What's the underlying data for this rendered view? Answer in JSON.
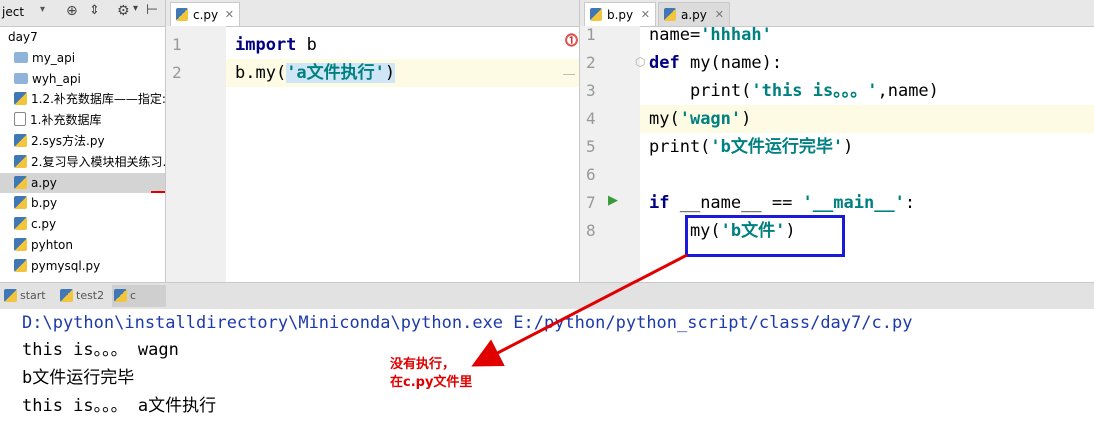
{
  "project_panel": {
    "header_label": "ject",
    "items": [
      {
        "label": "day7",
        "type": "folder-open"
      },
      {
        "label": "my_api",
        "type": "folder"
      },
      {
        "label": "wyh_api",
        "type": "folder"
      },
      {
        "label": "1.2.补充数据库——指定:",
        "type": "py"
      },
      {
        "label": "1.补充数据库",
        "type": "file"
      },
      {
        "label": "2.sys方法.py",
        "type": "py"
      },
      {
        "label": "2.复习导入模块相关练习.",
        "type": "py"
      },
      {
        "label": "a.py",
        "type": "py",
        "selected": true
      },
      {
        "label": "b.py",
        "type": "py"
      },
      {
        "label": "c.py",
        "type": "py"
      },
      {
        "label": "pyhton",
        "type": "py"
      },
      {
        "label": "pymysql.py",
        "type": "py"
      }
    ]
  },
  "editor_left": {
    "tabs": [
      {
        "label": "c.py",
        "active": true
      }
    ],
    "lines": [
      {
        "num": "1"
      },
      {
        "num": "2"
      }
    ],
    "code": {
      "l1_kw": "import",
      "l1_rest": " b",
      "l2_pre": "b.my(",
      "l2_str": "'a文件执行'",
      "l2_post": ")"
    }
  },
  "editor_right": {
    "tabs": [
      {
        "label": "b.py",
        "active": true
      },
      {
        "label": "a.py",
        "active": false
      }
    ],
    "line_numbers": [
      "1",
      "2",
      "3",
      "4",
      "5",
      "6",
      "7",
      "8"
    ],
    "code": {
      "l1_pre": "name=",
      "l1_str": "'hhhah'",
      "l2_kw": "def",
      "l2_rest": " my(name):",
      "l3_pre": "    print(",
      "l3_str": "'this is。。。'",
      "l3_post": ",name)",
      "l4_pre": "my(",
      "l4_str": "'wagn'",
      "l4_post": ")",
      "l5_pre": "print(",
      "l5_str": "'b文件运行完毕'",
      "l5_post": ")",
      "l7_kw": "if",
      "l7_mid": " __name__ == ",
      "l7_str": "'__main__'",
      "l7_post": ":",
      "l8_pre": "    my(",
      "l8_str": "'b文件'",
      "l8_post": ")"
    }
  },
  "run_tabs": [
    {
      "label": "start"
    },
    {
      "label": "test2"
    },
    {
      "label": "c",
      "active": true
    }
  ],
  "console_lines": [
    "D:\\python\\installdirectory\\Miniconda\\python.exe E:/python/python_script/class/day7/c.py",
    "this is。。。 wagn",
    "b文件运行完毕",
    "this is。。。 a文件执行"
  ],
  "annotation": {
    "line1": "没有执行，",
    "line2": "在c.py文件里"
  },
  "colors": {
    "annotation": "#e00000",
    "highlight_box": "#1a1adc",
    "keyword": "#000080",
    "string": "#008080"
  }
}
